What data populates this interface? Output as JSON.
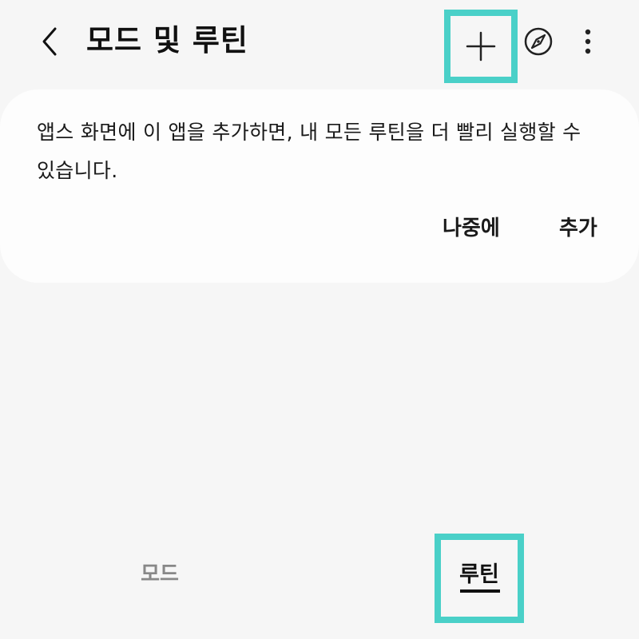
{
  "header": {
    "title": "모드 및 루틴",
    "back_icon": "chevron-left-icon",
    "add_icon": "plus-icon",
    "discover_icon": "compass-icon",
    "more_icon": "more-vertical-icon"
  },
  "card": {
    "message": "앱스 화면에 이 앱을 추가하면, 내 모든 루틴을 더 빨리 실행할 수 있습니다.",
    "later_label": "나중에",
    "add_label": "추가"
  },
  "tabs": [
    {
      "label": "모드",
      "selected": false
    },
    {
      "label": "루틴",
      "selected": true
    }
  ],
  "colors": {
    "highlight": "#4ad0c8",
    "background": "#f6f6f6",
    "card": "#fdfdfd"
  }
}
